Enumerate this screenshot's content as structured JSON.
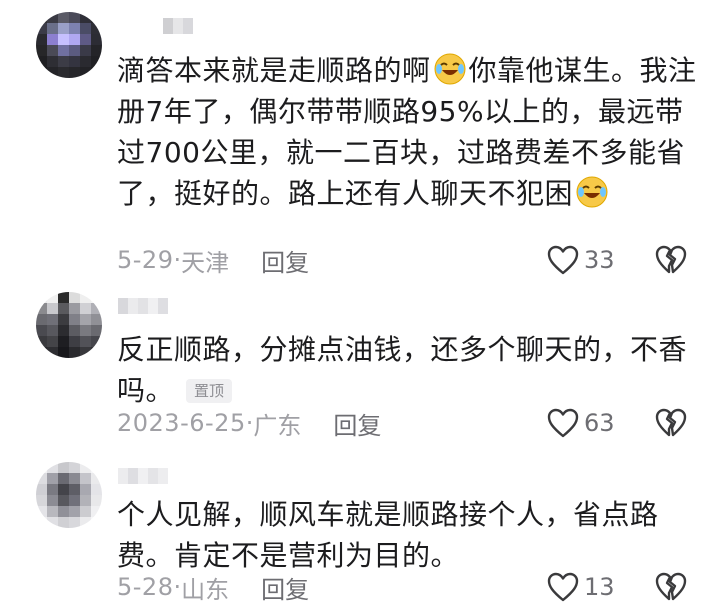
{
  "comments": [
    {
      "text_parts": [
        "滴答本来就是走顺路的啊",
        "你靠他谋生。我注册7年了，偶尔带带顺路95%以上的，最远带过700公里，就一二百块，过路费差不多能省了，挺好的。路上还有人聊天不犯困"
      ],
      "date": "5-29",
      "location": "天津",
      "reply_label": "回复",
      "likes": "33"
    },
    {
      "text": "反正顺路，分摊点油钱，还多个聊天的，不香吗。",
      "pin_label": "置顶",
      "date": "2023-6-25",
      "location": "广东",
      "reply_label": "回复",
      "likes": "63"
    },
    {
      "text": "个人见解，顺风车就是顺路接个人，省点路费。肯定不是营利为目的。",
      "date": "5-28",
      "location": "山东",
      "reply_label": "回复",
      "likes": "13"
    }
  ],
  "icons": {
    "like": "heart-outline-icon",
    "dislike": "broken-heart-icon",
    "emoji_1": "laughing-crying-emoji-icon",
    "emoji_2": "laughing-crying-emoji-icon"
  },
  "colors": {
    "text": "#1c1c1e",
    "meta": "#a0a0a5",
    "reply": "#6d6d72",
    "icon": "#3a3a3c"
  }
}
